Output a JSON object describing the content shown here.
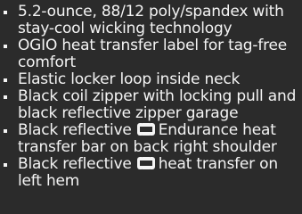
{
  "features": {
    "items": [
      {
        "lines": [
          "5.2-ounce, 88/12 poly/spandex with",
          "stay-cool wicking technology"
        ]
      },
      {
        "lines": [
          "OGIO heat transfer label for tag-free",
          "comfort"
        ]
      },
      {
        "lines": [
          "Elastic locker loop inside neck"
        ]
      },
      {
        "lines": [
          "Black coil zipper with locking pull and",
          "black reflective zipper garage"
        ]
      },
      {
        "before": "Black reflective",
        "after": "Endurance heat",
        "line2": "transfer bar on back right shoulder",
        "icon": "endurance-logo-icon"
      },
      {
        "before": "Black reflective",
        "after": "heat transfer on",
        "line2": "left hem",
        "icon": "endurance-logo-icon"
      }
    ]
  },
  "colors": {
    "background": "#2b2b2b",
    "text": "#f4f4f4"
  }
}
